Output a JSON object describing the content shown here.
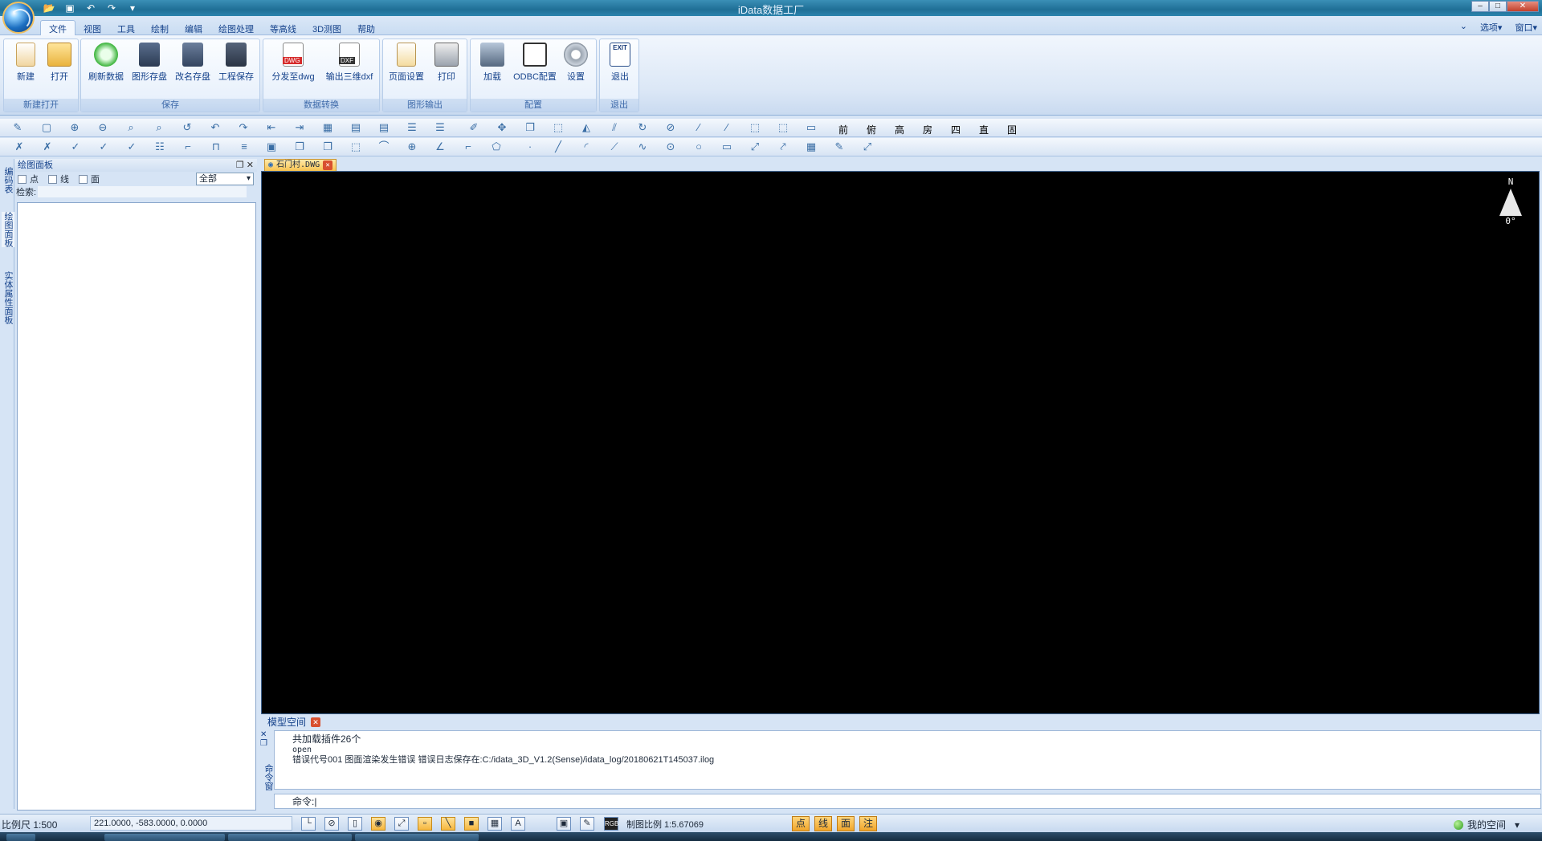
{
  "app": {
    "title": "iData数据工厂"
  },
  "menu_tabs": [
    "文件",
    "视图",
    "工具",
    "绘制",
    "编辑",
    "绘图处理",
    "等高线",
    "3D测图",
    "帮助"
  ],
  "right_menu": [
    "选项▾",
    "窗口▾"
  ],
  "ribbon": {
    "groups": [
      {
        "label": "新建打开",
        "buttons": [
          "新建",
          "打开"
        ]
      },
      {
        "label": "保存",
        "buttons": [
          "刷新数据",
          "图形存盘",
          "改名存盘",
          "工程保存"
        ]
      },
      {
        "label": "数据转换",
        "buttons": [
          "分发至dwg",
          "输出三维dxf"
        ]
      },
      {
        "label": "图形输出",
        "buttons": [
          "页面设置",
          "打印"
        ]
      },
      {
        "label": "配置",
        "buttons": [
          "加载",
          "ODBC配置",
          "设置"
        ]
      },
      {
        "label": "退出",
        "buttons": [
          "退出"
        ]
      }
    ],
    "icon_texts": {
      "dwg": "DWG",
      "dxf": "DXF",
      "exit": "EXIT"
    }
  },
  "toolbar_view_chars": [
    "前",
    "俯",
    "高",
    "房",
    "四",
    "直",
    "固"
  ],
  "dock_tabs": [
    "编码表",
    "绘图面板",
    "实体属性面板"
  ],
  "panel": {
    "title": "绘图面板",
    "filters": [
      "点",
      "线",
      "面"
    ],
    "filter_select": "全部",
    "search_label": "检索:"
  },
  "document": {
    "tab": "石门村.DWG",
    "compass_n": "N",
    "compass_angle": "0°"
  },
  "space_tab": "模型空间",
  "command": {
    "side_label": "命令窗",
    "lines": [
      "共加载插件26个",
      "open",
      "错误代号001 图面渲染发生错误 错误日志保存在:C:/idata_3D_V1.2(Sense)/idata_log/20180621T145037.ilog"
    ],
    "prompt": "命令:|"
  },
  "status": {
    "scale": "比例尺 1:500",
    "coords": "221.0000, -583.0000, 0.0000",
    "map_scale": "制图比例 1:5.67069",
    "point_tags": [
      "点",
      "线",
      "面",
      "注"
    ],
    "rgb": "RGB",
    "my_space": "我的空间"
  },
  "colors": {
    "accent": "#15428b",
    "canvas": "#000000",
    "tag": "#f0a52b"
  }
}
